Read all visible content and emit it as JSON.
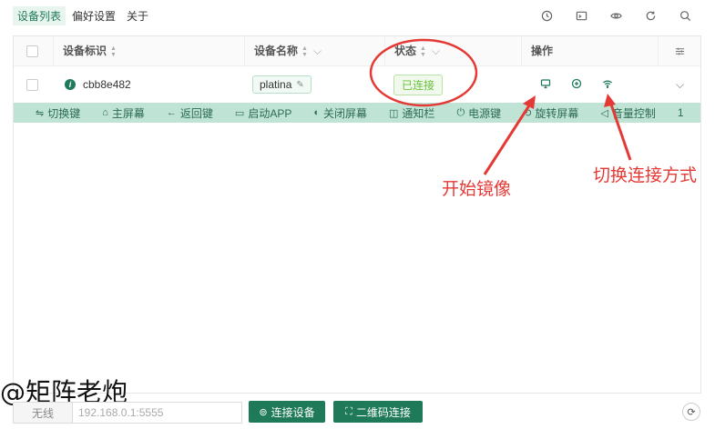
{
  "topnav": {
    "tabs": [
      {
        "label": "设备列表"
      },
      {
        "label": "偏好设置"
      },
      {
        "label": "关于"
      }
    ]
  },
  "table": {
    "headers": {
      "id": "设备标识",
      "name": "设备名称",
      "status": "状态",
      "ops": "操作"
    },
    "rows": [
      {
        "id": "cbb8e482",
        "name": "platina",
        "status": "已连接"
      }
    ]
  },
  "device_toolbar": {
    "items": [
      {
        "label": "切换键",
        "glyph": "⇋"
      },
      {
        "label": "主屏幕",
        "glyph": "⌂"
      },
      {
        "label": "返回键",
        "glyph": "←"
      },
      {
        "label": "启动APP",
        "glyph": "▭"
      },
      {
        "label": "关闭屏幕",
        "glyph": "◐"
      },
      {
        "label": "通知栏",
        "glyph": "◫"
      },
      {
        "label": "电源键",
        "glyph": "⏻"
      },
      {
        "label": "旋转屏幕",
        "glyph": "⟲"
      },
      {
        "label": "音量控制",
        "glyph": "◁"
      },
      {
        "label": "1",
        "glyph": ""
      }
    ]
  },
  "annotations": {
    "mirror": "开始镜像",
    "switch_connection": "切换连接方式"
  },
  "footer": {
    "prefix": "无线",
    "placeholder": "192.168.0.1:5555",
    "connect_label": "连接设备",
    "qr_label": "二维码连接"
  },
  "watermark": "@矩阵老炮",
  "colors": {
    "accent": "#1f7a5a",
    "toolbar_bg": "#bfe3d4",
    "annotation": "#e53935",
    "status_green": "#67c23a"
  }
}
